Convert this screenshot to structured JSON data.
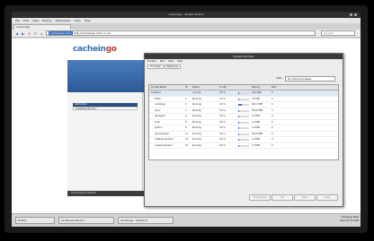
{
  "window": {
    "title": "cacheingo - Mozilla Firefox"
  },
  "browser": {
    "menu": [
      "File",
      "Edit",
      "View",
      "History",
      "Bookmarks",
      "Tools",
      "Help"
    ],
    "tab_title": "cacheingo",
    "url_host": "cacheingo.com",
    "url_rest": "http://cacheingo.mbo.co.uk",
    "search_placeholder": "Google"
  },
  "page": {
    "logo_main": "cacheingo",
    "logo_accent": "go",
    "left_panel_header": "Self-hosted",
    "left_panel_row": "cacheingo ftp rsync",
    "footer": "Home  Support  Website"
  },
  "dialog": {
    "title": "System Monitor",
    "menu": [
      "Monitor",
      "Edit",
      "View",
      "Help"
    ],
    "tabs": [
      "Processes",
      "Resources"
    ],
    "view_label": "View:",
    "view_value": "My active processes",
    "columns": [
      "Process Name",
      "ID",
      "Status",
      "% CPU",
      "",
      "Memory",
      "Nice"
    ],
    "rows": [
      {
        "name": "localhost",
        "id": "",
        "status": "running",
        "cpu": "0.0 %",
        "cpu_frac": 0.05,
        "mem": "54.4 MiB",
        "nice": "0",
        "indent": false
      },
      {
        "name": "firefox",
        "id": "1",
        "status": "Running",
        "cpu": "0.0 %",
        "cpu_frac": 0.1,
        "mem": "7.6 MiB",
        "nice": "0",
        "indent": true
      },
      {
        "name": "cacheingo",
        "id": "2",
        "status": "Running",
        "cpu": "2.0 %",
        "cpu_frac": 0.3,
        "mem": "204.3 MiB",
        "nice": "0",
        "indent": true
      },
      {
        "name": "rsync",
        "id": "3",
        "status": "Running",
        "cpu": "0.0 %",
        "cpu_frac": 0.05,
        "mem": "204.6 MiB",
        "nice": "0",
        "indent": true
      },
      {
        "name": "ssh-agent",
        "id": "4",
        "status": "Running",
        "cpu": "0.0 %",
        "cpu_frac": 0.05,
        "mem": "1.0 MiB",
        "nice": "0",
        "indent": true
      },
      {
        "name": "Xorg",
        "id": "5",
        "status": "Running",
        "cpu": "0.0 %",
        "cpu_frac": 0.05,
        "mem": "1.0 MiB",
        "nice": "0",
        "indent": true
      },
      {
        "name": "python",
        "id": "6",
        "status": "Running",
        "cpu": "0.0 %",
        "cpu_frac": 0.05,
        "mem": "1.0 MiB",
        "nice": "0",
        "indent": true
      },
      {
        "name": "gnome-panel",
        "id": "11",
        "status": "Running",
        "cpu": "0.0 %",
        "cpu_frac": 0.05,
        "mem": "154.8 MiB",
        "nice": "0",
        "indent": true
      },
      {
        "name": "metacity-window",
        "id": "14",
        "status": "Running",
        "cpu": "0.0 %",
        "cpu_frac": 0.05,
        "mem": "1.0 MiB",
        "nice": "0",
        "indent": true
      },
      {
        "name": "nautilus-daemon",
        "id": "16",
        "status": "Running",
        "cpu": "0.0 %",
        "cpu_frac": 0.05,
        "mem": "7.2 MiB",
        "nice": "0",
        "indent": true
      }
    ],
    "buttons": [
      "End Process",
      "Kill",
      "Help",
      "Close"
    ]
  },
  "taskbar": {
    "items": [
      "Firefox",
      "cacheingo Monitor",
      "cacheingo - Mozilla Fi"
    ],
    "clock_line1": "cacheingo Nets",
    "clock_line2": "Wed Oct 8 2008"
  },
  "colors": {
    "accent": "#3a6fc0",
    "banner": "#4a7dbf",
    "logo_accent": "#c0392b"
  }
}
